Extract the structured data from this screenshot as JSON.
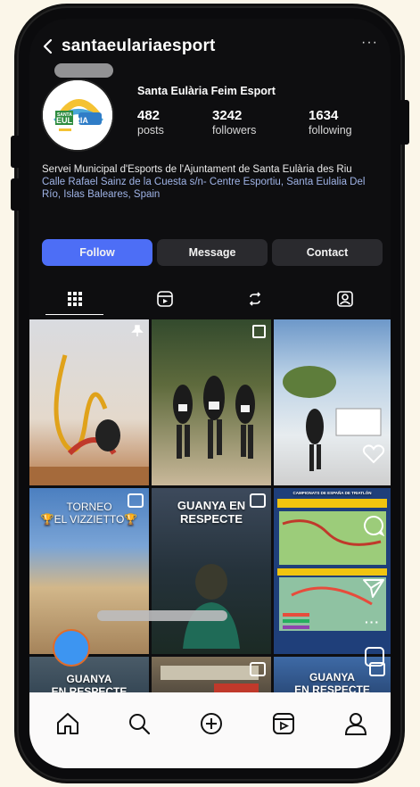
{
  "header": {
    "username": "santaeulariaesport",
    "more_label": "···"
  },
  "profile": {
    "display_name": "Santa Eulària Feim Esport",
    "avatar_text_top": "SANTA",
    "avatar_text_bottom": "EUL RIA",
    "stats": [
      {
        "number": "482",
        "label": "posts"
      },
      {
        "number": "3242",
        "label": "followers"
      },
      {
        "number": "1634",
        "label": "following"
      }
    ],
    "bio": "Servei Municipal d'Esports de l'Ajuntament de Santa Eulària des Riu",
    "address": "Calle Rafael Sainz de la Cuesta s/n- Centre Esportiu, Santa Eulalia Del Río, Islas Baleares, Spain"
  },
  "actions": {
    "follow": "Follow",
    "message": "Message",
    "contact": "Contact"
  },
  "grid": {
    "posts": [
      {
        "caption": ""
      },
      {
        "caption": ""
      },
      {
        "caption": ""
      },
      {
        "caption": "TORNEO\n🏆EL VIZZIETTO🏆"
      },
      {
        "caption": "GUANYA EN\nRESPECTE"
      },
      {
        "caption": "CAMPIONATS DE ESPAÑA DE TRIATLÓN"
      },
      {
        "caption": "GUANYA\nEN RESPECTE"
      },
      {
        "caption": ""
      },
      {
        "caption": "GUANYA\nEN RESPECTE"
      }
    ]
  },
  "colors": {
    "follow_button": "#4d6ef6",
    "screen_bg": "#0e0e10",
    "address_link": "#9fb3e6"
  }
}
